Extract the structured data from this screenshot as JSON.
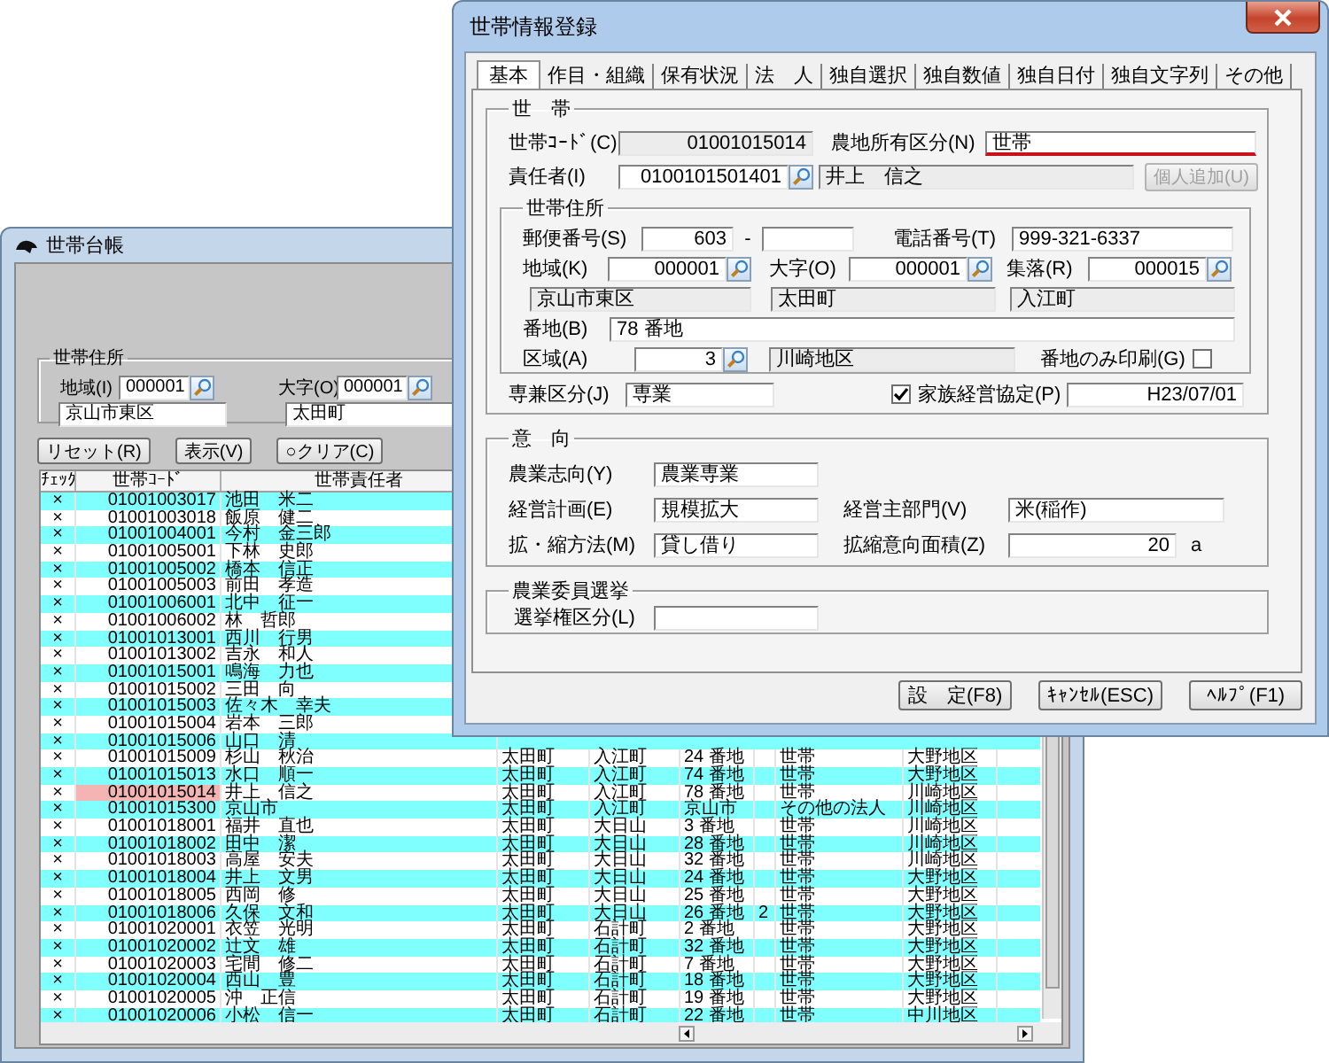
{
  "list_window": {
    "title": "世帯台帳",
    "address_group": {
      "title": "世帯住所",
      "fields": [
        {
          "label": "地域(I)",
          "code": "000001",
          "name": "京山市東区"
        },
        {
          "label": "大字(O)",
          "code": "000001",
          "name": "太田町"
        }
      ]
    },
    "buttons": [
      "リセット(R)",
      "表示(V)",
      "○クリア(C)"
    ],
    "table": {
      "columns": [
        "ﾁｪｯｸ",
        "世帯ｺｰﾄﾞ",
        "世帯責任者"
      ],
      "rows": [
        {
          "check": "×",
          "code": "01001003017",
          "name": "池田　米二",
          "selected": false
        },
        {
          "check": "×",
          "code": "01001003018",
          "name": "飯原　健二",
          "selected": false
        },
        {
          "check": "×",
          "code": "01001004001",
          "name": "今村　金三郎",
          "selected": false
        },
        {
          "check": "×",
          "code": "01001005001",
          "name": "下林　史郎",
          "selected": false
        },
        {
          "check": "×",
          "code": "01001005002",
          "name": "橋本　信正",
          "selected": false
        },
        {
          "check": "×",
          "code": "01001005003",
          "name": "前田　孝造",
          "selected": false
        },
        {
          "check": "×",
          "code": "01001006001",
          "name": "北中　征一",
          "selected": false
        },
        {
          "check": "×",
          "code": "01001006002",
          "name": "林　哲郎",
          "selected": false
        },
        {
          "check": "×",
          "code": "01001013001",
          "name": "西川　行男",
          "selected": false
        },
        {
          "check": "×",
          "code": "01001013002",
          "name": "吉永　和人",
          "selected": false
        },
        {
          "check": "×",
          "code": "01001015001",
          "name": "鳴海　力也",
          "selected": false
        },
        {
          "check": "×",
          "code": "01001015002",
          "name": "三田　向",
          "selected": false
        },
        {
          "check": "×",
          "code": "01001015003",
          "name": "佐々木　幸夫",
          "selected": false
        },
        {
          "check": "×",
          "code": "01001015004",
          "name": "岩本　三郎",
          "selected": false
        },
        {
          "check": "×",
          "code": "01001015006",
          "name": "山口　清",
          "selected": false
        },
        {
          "check": "×",
          "code": "01001015009",
          "name": "杉山　秋治",
          "selected": false,
          "detail": {
            "town": "太田町",
            "village": "入江町",
            "lot": "24 番地",
            "type": "世帯",
            "district": "大野地区"
          }
        },
        {
          "check": "×",
          "code": "01001015013",
          "name": "水口　順一",
          "selected": false,
          "detail": {
            "town": "太田町",
            "village": "入江町",
            "lot": "74 番地",
            "type": "世帯",
            "district": "大野地区"
          }
        },
        {
          "check": "×",
          "code": "01001015014",
          "name": "井上　信之",
          "selected": true,
          "detail": {
            "town": "太田町",
            "village": "入江町",
            "lot": "78 番地",
            "type": "世帯",
            "district": "川崎地区"
          }
        },
        {
          "check": "×",
          "code": "01001015300",
          "name": "京山市",
          "selected": false,
          "detail": {
            "town": "太田町",
            "village": "入江町",
            "lot": "京山市",
            "type": "その他の法人",
            "district": "川崎地区"
          }
        },
        {
          "check": "×",
          "code": "01001018001",
          "name": "福井　直也",
          "selected": false,
          "detail": {
            "town": "太田町",
            "village": "大日山",
            "lot": "3 番地",
            "type": "世帯",
            "district": "川崎地区"
          }
        },
        {
          "check": "×",
          "code": "01001018002",
          "name": "田中　潔",
          "selected": false,
          "detail": {
            "town": "太田町",
            "village": "大日山",
            "lot": "28 番地",
            "type": "世帯",
            "district": "川崎地区"
          }
        },
        {
          "check": "×",
          "code": "01001018003",
          "name": "高屋　安夫",
          "selected": false,
          "detail": {
            "town": "太田町",
            "village": "大日山",
            "lot": "32 番地",
            "type": "世帯",
            "district": "川崎地区"
          }
        },
        {
          "check": "×",
          "code": "01001018004",
          "name": "井上　文男",
          "selected": false,
          "detail": {
            "town": "太田町",
            "village": "大日山",
            "lot": "24 番地",
            "type": "世帯",
            "district": "大野地区"
          }
        },
        {
          "check": "×",
          "code": "01001018005",
          "name": "西岡　修",
          "selected": false,
          "detail": {
            "town": "太田町",
            "village": "大日山",
            "lot": "25 番地",
            "type": "世帯",
            "district": "大野地区"
          }
        },
        {
          "check": "×",
          "code": "01001018006",
          "name": "久保　文和",
          "selected": false,
          "detail": {
            "town": "太田町",
            "village": "大日山",
            "lot": "26 番地",
            "lot_sub": "2",
            "type": "世帯",
            "district": "大野地区"
          }
        },
        {
          "check": "×",
          "code": "01001020001",
          "name": "衣笠　光明",
          "selected": false,
          "detail": {
            "town": "太田町",
            "village": "石計町",
            "lot": "2 番地",
            "type": "世帯",
            "district": "大野地区"
          }
        },
        {
          "check": "×",
          "code": "01001020002",
          "name": "辻文　雄",
          "selected": false,
          "detail": {
            "town": "太田町",
            "village": "石計町",
            "lot": "32 番地",
            "type": "世帯",
            "district": "大野地区"
          }
        },
        {
          "check": "×",
          "code": "01001020003",
          "name": "宅間　修二",
          "selected": false,
          "detail": {
            "town": "太田町",
            "village": "石計町",
            "lot": "7 番地",
            "type": "世帯",
            "district": "大野地区"
          }
        },
        {
          "check": "×",
          "code": "01001020004",
          "name": "西山　豊",
          "selected": false,
          "detail": {
            "town": "太田町",
            "village": "石計町",
            "lot": "18 番地",
            "type": "世帯",
            "district": "大野地区"
          }
        },
        {
          "check": "×",
          "code": "01001020005",
          "name": "沖　正信",
          "selected": false,
          "detail": {
            "town": "太田町",
            "village": "石計町",
            "lot": "19 番地",
            "type": "世帯",
            "district": "大野地区"
          }
        },
        {
          "check": "×",
          "code": "01001020006",
          "name": "小松　信一",
          "selected": false,
          "detail": {
            "town": "太田町",
            "village": "石計町",
            "lot": "22 番地",
            "type": "世帯",
            "district": "中川地区"
          }
        }
      ]
    }
  },
  "dialog": {
    "title": "世帯情報登録",
    "tabs": [
      {
        "label": "基本",
        "selected": true
      },
      {
        "label": "作目・組織",
        "selected": false
      },
      {
        "label": "保有状況",
        "selected": false
      },
      {
        "label": "法　人",
        "selected": false
      },
      {
        "label": "独自選択",
        "selected": false
      },
      {
        "label": "独自数値",
        "selected": false
      },
      {
        "label": "独自日付",
        "selected": false
      },
      {
        "label": "独自文字列",
        "selected": false
      },
      {
        "label": "その他",
        "selected": false
      }
    ],
    "household": {
      "title": "世　帯",
      "code_label": "世帯ｺｰﾄﾞ(C)",
      "code": "01001015014",
      "farmland_label": "農地所有区分(N)",
      "farmland": "世帯",
      "farmland_focused": true,
      "head_label": "責任者(I)",
      "head_code": "0100101501401",
      "head_name": "井上　信之",
      "add_button": {
        "label": "個人追加(U)",
        "disabled": true
      },
      "address": {
        "title": "世帯住所",
        "postal_label": "郵便番号(S)",
        "postal": "603",
        "postal_dash": "-",
        "phone_label": "電話番号(T)",
        "phone": "999-321-6337",
        "region_label": "地域(K)",
        "region_code": "000001",
        "region_name": "京山市東区",
        "ooaza_label": "大字(O)",
        "ooaza_code": "000001",
        "ooaza_name": "太田町",
        "village_label": "集落(R)",
        "village_code": "000015",
        "village_name": "入江町",
        "lot_label": "番地(B)",
        "lot": "78 番地",
        "zone_label": "区域(A)",
        "zone_code": "3",
        "zone_name": "川崎地区",
        "lot_only_label": "番地のみ印刷(G)",
        "lot_only_checked": false
      },
      "type_label": "専兼区分(J)",
      "type": "専業",
      "agreement_label": "家族経営協定(P)",
      "agreement_checked": true,
      "agreement_date": "H23/07/01"
    },
    "intent": {
      "title": "意　向",
      "orientation_label": "農業志向(Y)",
      "orientation": "農業専業",
      "plan_label": "経営計画(E)",
      "plan": "規模拡大",
      "sector_label": "経営主部門(V)",
      "sector": "米(稲作)",
      "method_label": "拡・縮方法(M)",
      "method": "貸し借り",
      "area_label": "拡縮意向面積(Z)",
      "area": "20",
      "area_unit": "a"
    },
    "election": {
      "title": "農業委員選挙",
      "right_label": "選挙権区分(L)"
    },
    "buttons": [
      "設　定(F8)",
      "ｷｬﾝｾﾙ(ESC)",
      "ﾍﾙﾌﾟ(F1)"
    ]
  }
}
